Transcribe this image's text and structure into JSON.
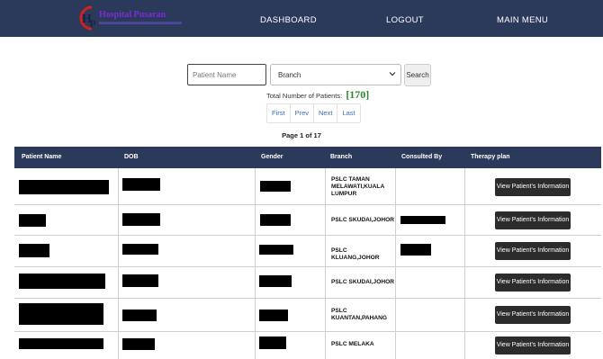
{
  "header": {
    "logo_title": "Hospital Pusaran",
    "nav": [
      "DASHBOARD",
      "LOGOUT",
      "MAIN MENU"
    ]
  },
  "search": {
    "name_placeholder": "Patient Name",
    "branch_selected": "Branch",
    "button_label": "Search"
  },
  "summary": {
    "total_label": "Total Number of Patients:",
    "total_count": "[170]"
  },
  "pagination": {
    "buttons": [
      "First",
      "Prev",
      "Next",
      "Last"
    ],
    "page_info": "Page 1 of 17"
  },
  "table": {
    "columns": [
      "Patient Name",
      "DOB",
      "Gender",
      "Branch",
      "Consulted By",
      "Therapy plan"
    ],
    "rows": [
      {
        "branch": "PSLC TAMAN MELAWATI,KUALA LUMPUR",
        "action": "View Patient's Information"
      },
      {
        "branch": "PSLC SKUDAI,JOHOR",
        "action": "View Patient's Information"
      },
      {
        "branch": "PSLC KLUANG,JOHOR",
        "action": "View Patient's Information"
      },
      {
        "branch": "PSLC SKUDAI,JOHOR",
        "action": "View Patient's Information"
      },
      {
        "branch": "PSLC KUANTAN,PAHANG",
        "action": "View Patient's Information"
      },
      {
        "branch": "PSLC MELAKA",
        "action": "View Patient's Information"
      }
    ]
  },
  "colors": {
    "navbar": "#2b3a5b",
    "count_green": "#2f8a2f",
    "link_blue": "#3a6db5",
    "button_dark": "#2c2c2c"
  }
}
